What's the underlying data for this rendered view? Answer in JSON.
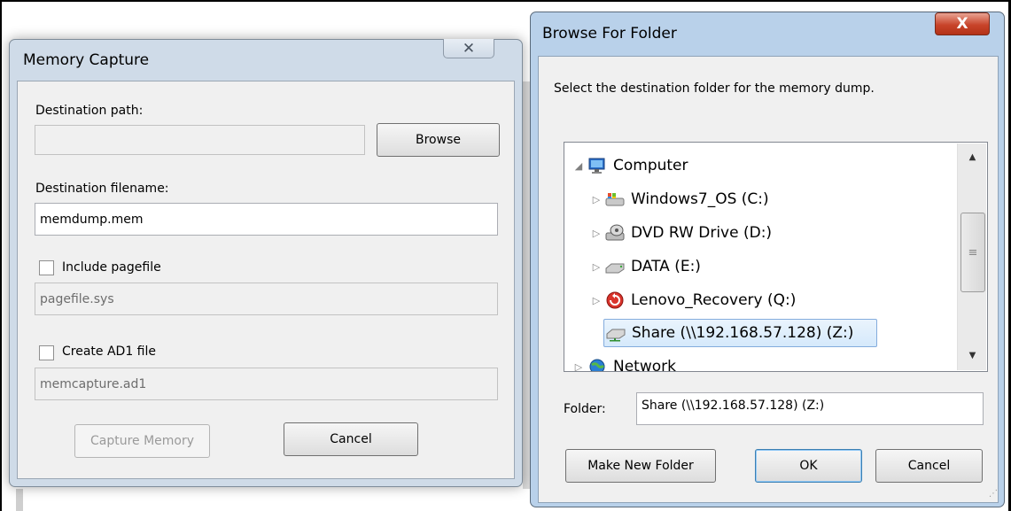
{
  "memory_capture": {
    "title": "Memory Capture",
    "close_glyph": "✕",
    "destination_path_label": "Destination path:",
    "destination_path_value": "",
    "browse_label": "Browse",
    "destination_filename_label": "Destination filename:",
    "destination_filename_value": "memdump.mem",
    "include_pagefile_label": "Include pagefile",
    "pagefile_value": "pagefile.sys",
    "create_ad1_label": "Create AD1 file",
    "ad1_value": "memcapture.ad1",
    "capture_label": "Capture Memory",
    "cancel_label": "Cancel"
  },
  "browse_folder": {
    "title": "Browse For Folder",
    "close_glyph": "X",
    "instruction": "Select the destination folder for the memory dump.",
    "tree": [
      {
        "label": "Computer",
        "expander": "◢",
        "icon": "computer-icon"
      },
      {
        "label": "Windows7_OS (C:)",
        "expander": "▷",
        "icon": "os-drive-icon"
      },
      {
        "label": "DVD RW Drive (D:)",
        "expander": "▷",
        "icon": "dvd-drive-icon"
      },
      {
        "label": "DATA (E:)",
        "expander": "▷",
        "icon": "hard-drive-icon"
      },
      {
        "label": "Lenovo_Recovery (Q:)",
        "expander": "▷",
        "icon": "recovery-drive-icon"
      },
      {
        "label": "Share (\\\\192.168.57.128) (Z:)",
        "expander": "",
        "icon": "network-drive-icon"
      },
      {
        "label": "Network",
        "expander": "▷",
        "icon": "network-icon"
      }
    ],
    "folder_label": "Folder:",
    "folder_value": "Share (\\\\192.168.57.128) (Z:)",
    "make_new_folder_label": "Make New Folder",
    "ok_label": "OK",
    "cancel_label": "Cancel"
  }
}
